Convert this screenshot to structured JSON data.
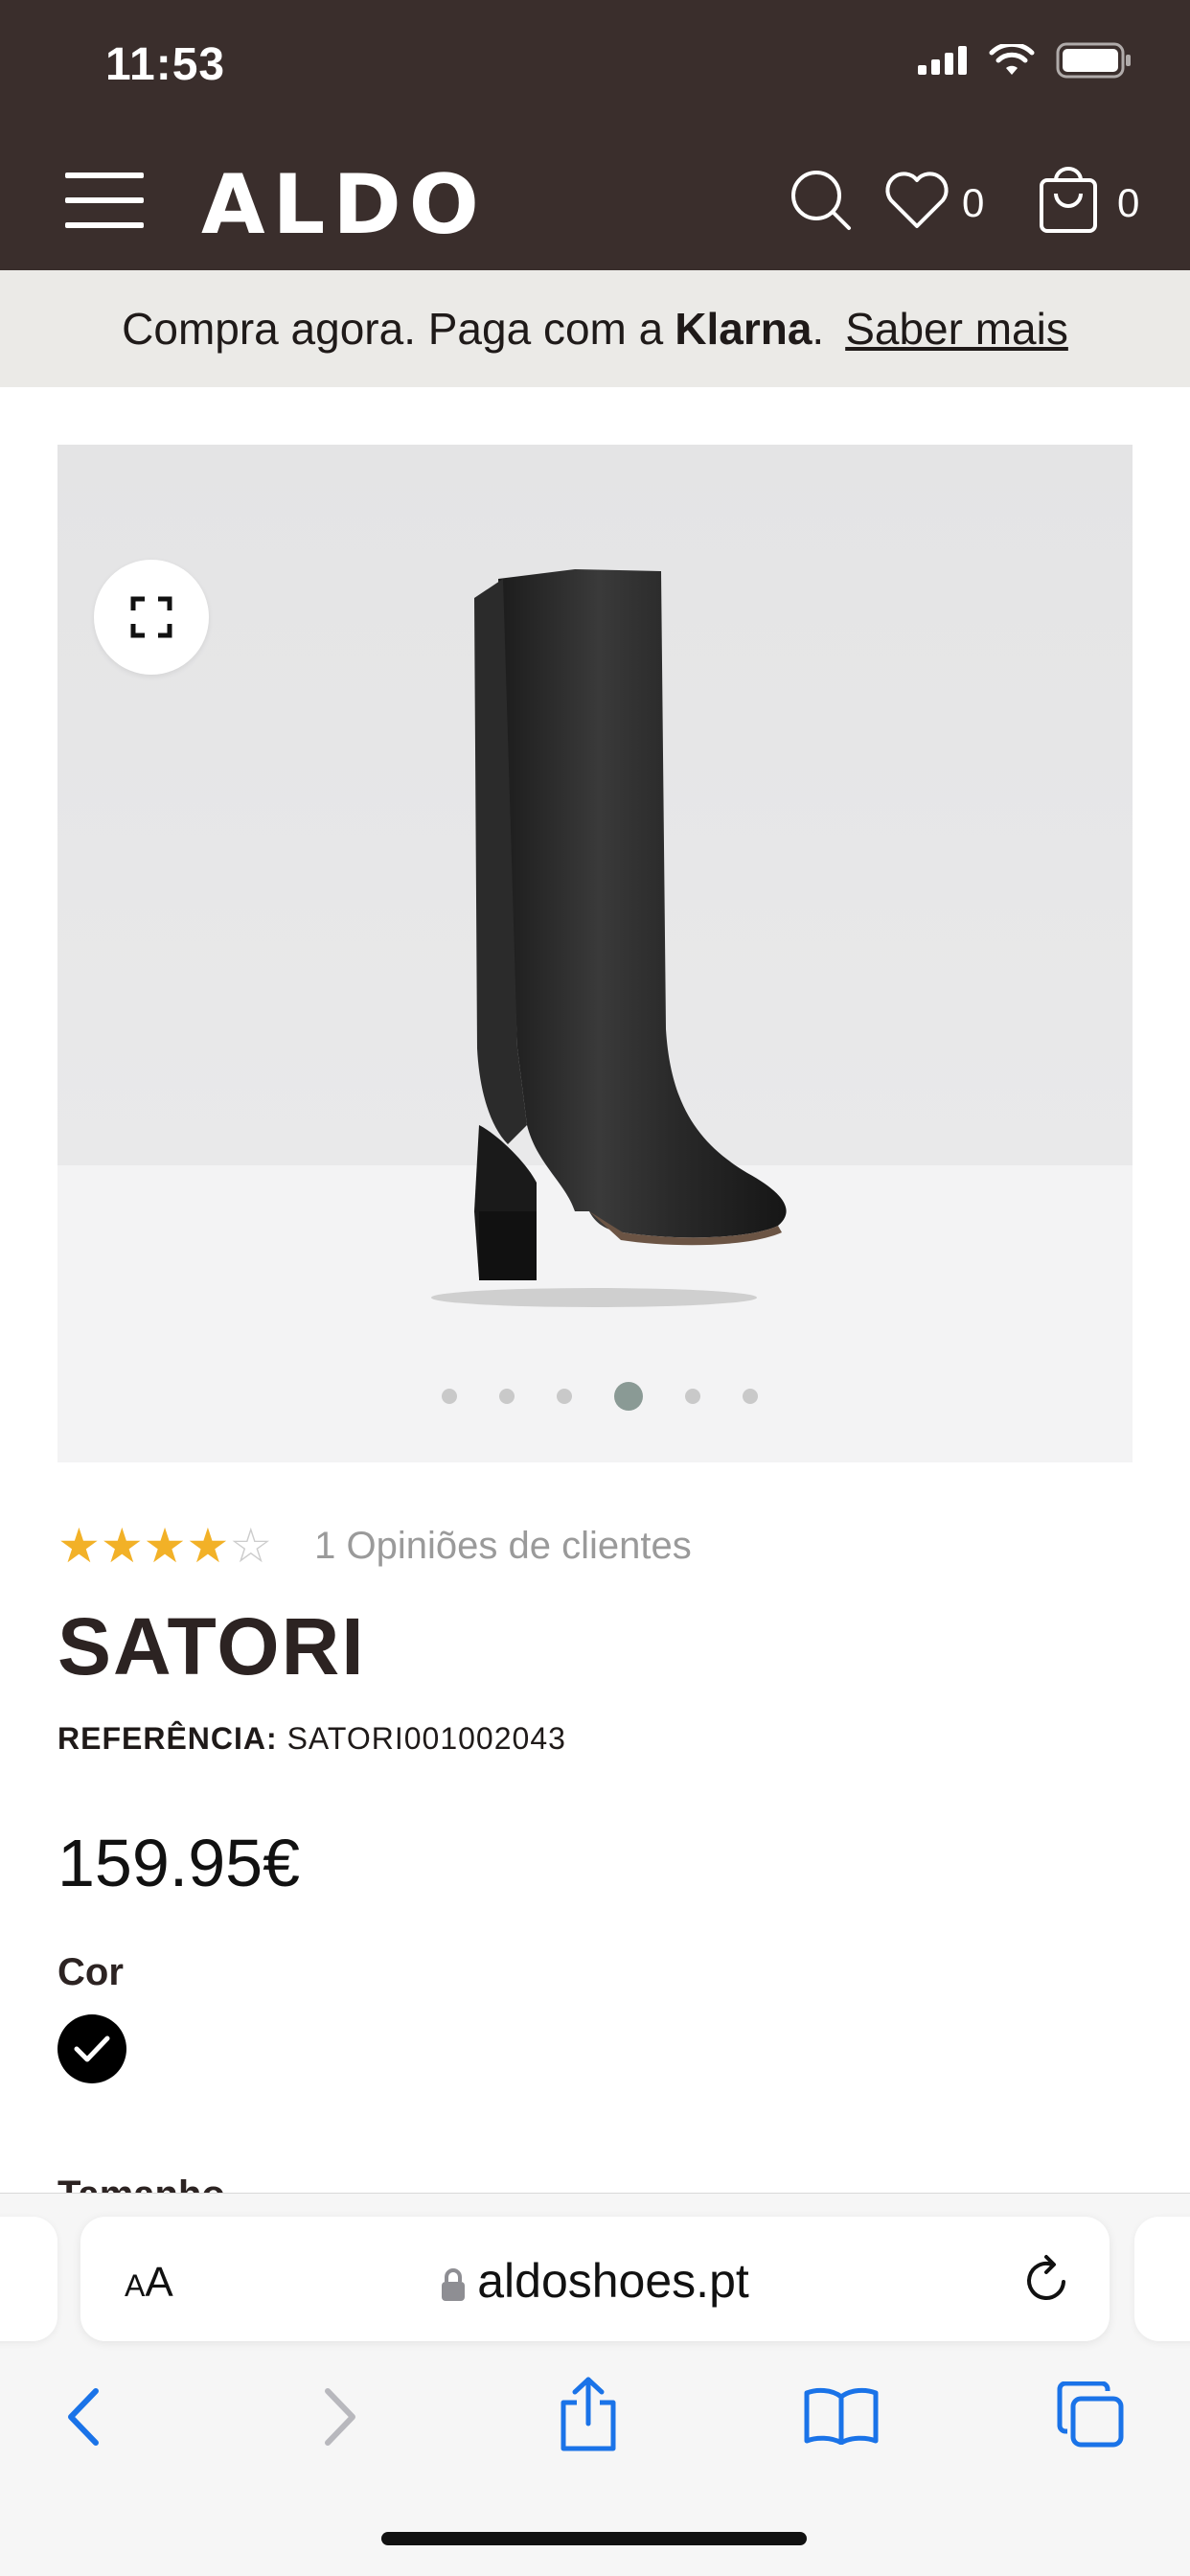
{
  "status_bar": {
    "time": "11:53"
  },
  "header": {
    "logo": "ALDO",
    "wishlist_count": "0",
    "cart_count": "0"
  },
  "promo": {
    "text": "Compra agora. Paga com a",
    "brand": "Klarna",
    "period": ".",
    "link": "Saber mais"
  },
  "gallery": {
    "image_count": 6,
    "active_index": 4
  },
  "product": {
    "rating": 4,
    "rating_max": 5,
    "reviews_text": "1 Opiniões de clientes",
    "name": "SATORI",
    "reference_label": "REFERÊNCIA:",
    "reference_value": "SATORI001002043",
    "price": "159.95€",
    "color_label": "Cor",
    "selected_color": "#000000",
    "size_label": "Tamanho"
  },
  "browser": {
    "aa_label": "AA",
    "url": "aldoshoes.pt"
  },
  "colors": {
    "header_bg": "#3a2e2c",
    "promo_bg": "#ebeae7",
    "star": "#f2b127",
    "safari_blue": "#1a73e8"
  },
  "icons": {
    "menu": "hamburger-menu-icon",
    "search": "search-icon",
    "wishlist": "heart-icon",
    "cart": "shopping-bag-icon",
    "expand": "fullscreen-icon",
    "lock": "lock-icon",
    "reload": "reload-icon",
    "back": "chevron-left-icon",
    "forward": "chevron-right-icon",
    "share": "share-icon",
    "bookmarks": "book-icon",
    "tabs": "tabs-icon"
  }
}
